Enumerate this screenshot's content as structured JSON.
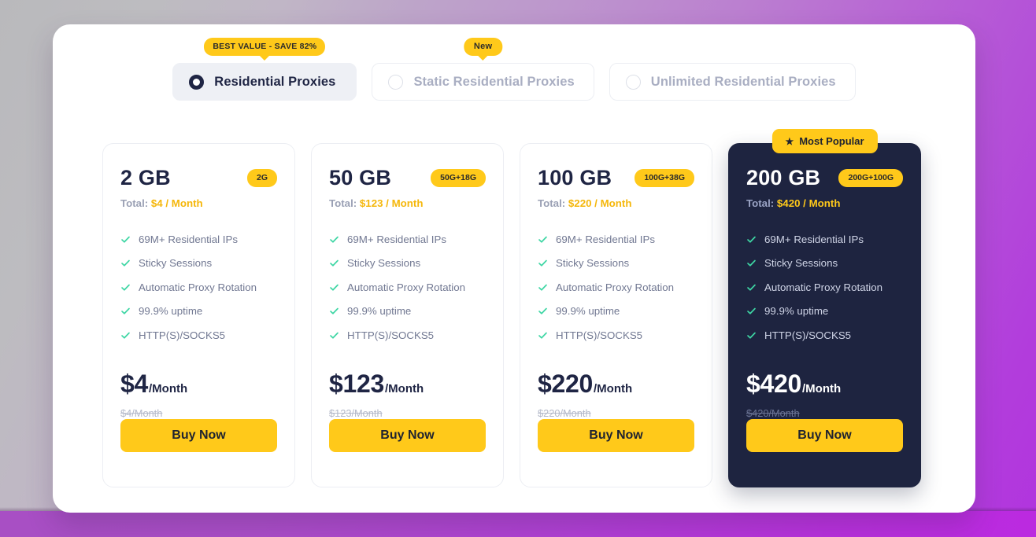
{
  "tabs": [
    {
      "label": "Residential Proxies",
      "badge": "BEST VALUE - SAVE 82%",
      "selected": true,
      "radio_icon": "radio-selected-icon"
    },
    {
      "label": "Static Residential Proxies",
      "badge": "New",
      "selected": false,
      "radio_icon": "radio-unselected-icon"
    },
    {
      "label": "Unlimited Residential Proxies",
      "badge": "",
      "selected": false,
      "radio_icon": "radio-unselected-icon"
    }
  ],
  "plans": [
    {
      "size": "2 GB",
      "size_badge": "2G",
      "total_prefix": "Total:",
      "total_amount": "$4 / Month",
      "price": "$4",
      "price_per": "/Month",
      "old_price": "$4/Month",
      "buy_label": "Buy Now",
      "featured": false,
      "popular_badge": ""
    },
    {
      "size": "50 GB",
      "size_badge": "50G+18G",
      "total_prefix": "Total:",
      "total_amount": "$123 / Month",
      "price": "$123",
      "price_per": "/Month",
      "old_price": "$123/Month",
      "buy_label": "Buy Now",
      "featured": false,
      "popular_badge": ""
    },
    {
      "size": "100 GB",
      "size_badge": "100G+38G",
      "total_prefix": "Total:",
      "total_amount": "$220 / Month",
      "price": "$220",
      "price_per": "/Month",
      "old_price": "$220/Month",
      "buy_label": "Buy Now",
      "featured": false,
      "popular_badge": ""
    },
    {
      "size": "200 GB",
      "size_badge": "200G+100G",
      "total_prefix": "Total:",
      "total_amount": "$420 / Month",
      "price": "$420",
      "price_per": "/Month",
      "old_price": "$420/Month",
      "buy_label": "Buy Now",
      "featured": true,
      "popular_badge": "Most Popular",
      "popular_icon": "star-icon"
    }
  ],
  "features": [
    "69M+ Residential IPs",
    "Sticky Sessions",
    "Automatic Proxy Rotation",
    "99.9% uptime",
    "HTTP(S)/SOCKS5"
  ],
  "colors": {
    "accent_yellow": "#ffc91a",
    "dark_navy": "#1e2440",
    "check_green": "#3ed6a4",
    "muted_text": "#717892",
    "total_amount": "#f5b70b"
  }
}
